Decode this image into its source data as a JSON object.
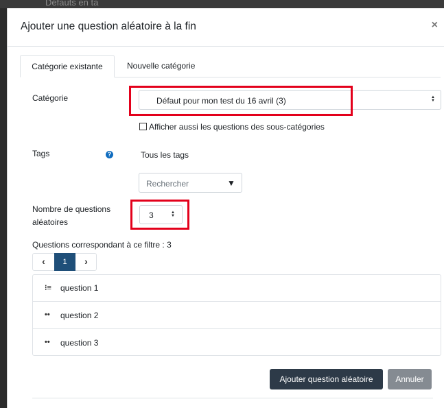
{
  "background": {
    "top_text": "Défauts en ta"
  },
  "dialog": {
    "title": "Ajouter une question aléatoire à la fin",
    "close": "×"
  },
  "tabs": [
    {
      "label": "Catégorie existante",
      "active": true
    },
    {
      "label": "Nouvelle catégorie",
      "active": false
    }
  ],
  "form": {
    "category_label": "Catégorie",
    "category_value": "Défaut pour mon test du 16 avril (3)",
    "subcategories_label": "Afficher aussi les questions des sous-catégories",
    "subcategories_checked": false,
    "tags_label": "Tags",
    "tags_help": "?",
    "tags_value": "Tous les tags",
    "search_placeholder": "Rechercher",
    "search_caret": "▼",
    "count_label_line1": "Nombre de questions",
    "count_label_line2": "aléatoires",
    "count_value": "3",
    "matching_label": "Questions correspondant à ce filtre : 3"
  },
  "pager": {
    "prev": "‹",
    "current": "1",
    "next": "›"
  },
  "questions": [
    {
      "icon": "⁝≡",
      "icon_name": "multichoice-icon",
      "label": "question 1"
    },
    {
      "icon": "••",
      "icon_name": "truefalse-icon",
      "label": "question 2"
    },
    {
      "icon": "••",
      "icon_name": "truefalse-icon",
      "label": "question 3"
    }
  ],
  "buttons": {
    "submit": "Ajouter question aléatoire",
    "cancel": "Annuler"
  },
  "colors": {
    "highlight": "#e3001b",
    "primary_button": "#2d3a48",
    "secondary_button": "#858b92",
    "pager_active": "#1f4f79",
    "help_icon": "#0f6cbf"
  }
}
